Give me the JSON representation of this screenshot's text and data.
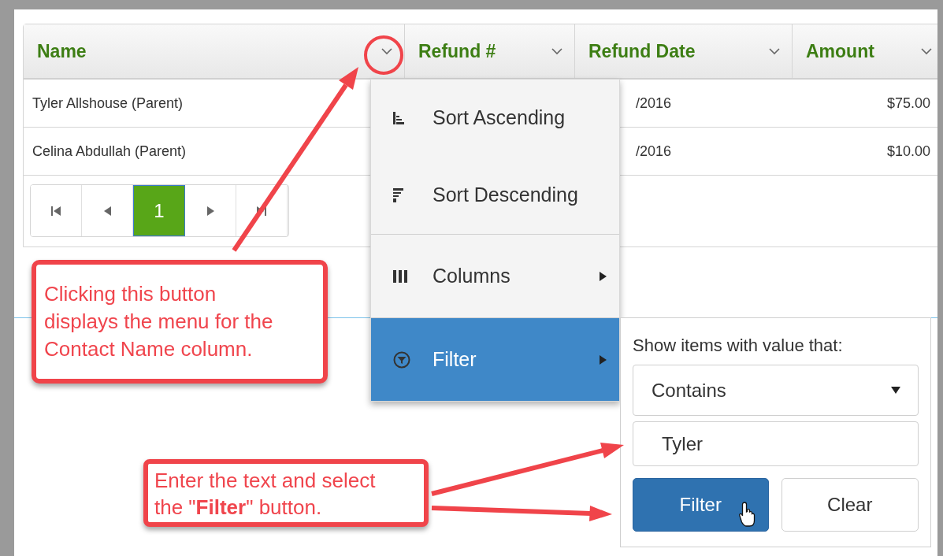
{
  "grid": {
    "columns": [
      {
        "label": "Name",
        "kind": "name"
      },
      {
        "label": "Refund #",
        "kind": "number"
      },
      {
        "label": "Refund Date",
        "kind": "date"
      },
      {
        "label": "Amount",
        "kind": "amount"
      }
    ],
    "rows": [
      {
        "name": "Tyler Allshouse (Parent)",
        "refund_date": "/2016",
        "amount": "$75.00"
      },
      {
        "name": "Celina Abdullah (Parent)",
        "refund_date": "/2016",
        "amount": "$10.00"
      }
    ],
    "pager": {
      "pages": [
        {
          "label": "1",
          "selected": true
        }
      ]
    }
  },
  "column_menu": {
    "sections": [
      {
        "items": [
          {
            "kind": "sort_ascending",
            "label": "Sort Ascending",
            "selected": false,
            "submenu": false
          },
          {
            "kind": "sort_descending",
            "label": "Sort Descending",
            "selected": false,
            "submenu": false
          }
        ]
      },
      {
        "items": [
          {
            "kind": "columns",
            "label": "Columns",
            "selected": false,
            "submenu": true
          }
        ]
      },
      {
        "items": [
          {
            "kind": "filter",
            "label": "Filter",
            "selected": true,
            "submenu": true
          }
        ]
      }
    ]
  },
  "filter_panel": {
    "label": "Show items with value that:",
    "operator": "Contains",
    "value": "Tyler",
    "buttons": [
      {
        "label": "Filter",
        "primary": true
      },
      {
        "label": "Clear",
        "primary": false
      }
    ]
  },
  "callouts": [
    {
      "text": "Clicking this button displays the menu for the Contact Name column."
    },
    {
      "text": "Enter the text and select the \"**Filter**\" button."
    }
  ]
}
